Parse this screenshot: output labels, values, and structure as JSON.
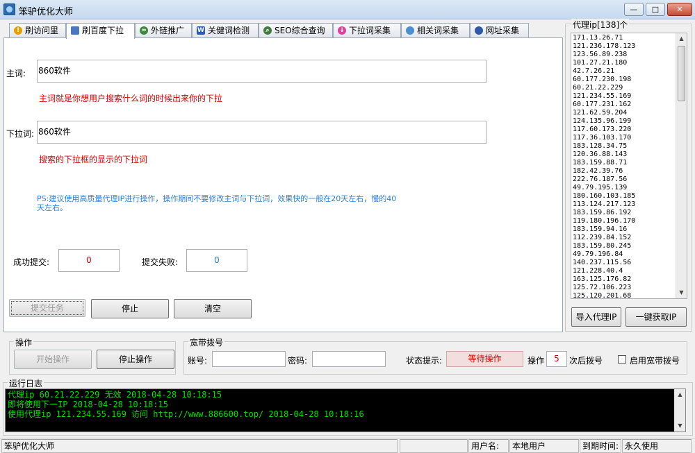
{
  "window": {
    "title": "笨驴优化大师",
    "min_label": "—",
    "max_label": "□",
    "close_label": "✕"
  },
  "tabs": [
    {
      "label": "刷访问里",
      "icon": "warning-icon",
      "color": "#e8a000"
    },
    {
      "label": "刷百度下拉",
      "icon": "page-icon",
      "color": "#4a78c0"
    },
    {
      "label": "外链推广",
      "icon": "link-icon",
      "color": "#3a8a3a"
    },
    {
      "label": "关健词检测",
      "icon": "word-icon",
      "color": "#2b5db8"
    },
    {
      "label": "SEO综合查询",
      "icon": "magnifier-icon",
      "color": "#3f7d3f"
    },
    {
      "label": "下拉词采集",
      "icon": "arrow-down-icon",
      "color": "#e0409a"
    },
    {
      "label": "相关词采集",
      "icon": "globe-icon",
      "color": "#4a90d0"
    },
    {
      "label": "网址采集",
      "icon": "globe-icon",
      "color": "#2f5aa8"
    }
  ],
  "form": {
    "main_label": "主词:",
    "main_value": "860软件",
    "main_hint": "主词就是你想用户搜索什么词的时候出来你的下拉",
    "dropdown_label": "下拉词:",
    "dropdown_value": "860软件",
    "dropdown_hint": "搜索的下拉框的显示的下拉词",
    "ps_note": "PS:建议使用高质量代理IP进行操作，操作期间不要修改主词与下拉词，效果快的一般在20天左右，慢的40天左右。",
    "success_label": "成功提交:",
    "success_value": "0",
    "fail_label": "提交失败:",
    "fail_value": "0",
    "submit_button": "提交任务",
    "stop_button": "停止",
    "clear_button": "清空"
  },
  "proxy": {
    "title": "代理ip[138]个",
    "list": [
      "171.13.26.71",
      "121.236.178.123",
      "123.56.89.238",
      "101.27.21.180",
      "42.7.26.21",
      "60.177.230.198",
      "60.21.22.229",
      "121.234.55.169",
      "60.177.231.162",
      "121.62.59.204",
      "124.135.96.199",
      "117.60.173.220",
      "117.36.103.170",
      "183.128.34.75",
      "120.36.88.143",
      "183.159.88.71",
      "182.42.39.76",
      "222.76.187.56",
      "49.79.195.139",
      "180.160.103.185",
      "113.124.217.123",
      "183.159.86.192",
      "119.180.196.170",
      "183.159.94.16",
      "112.239.84.152",
      "183.159.80.245",
      "49.79.196.84",
      "140.237.115.56",
      "121.228.40.4",
      "163.125.176.82",
      "125.72.106.223",
      "125.120.201.68"
    ],
    "import_button": "导入代理IP",
    "fetch_button": "一键获取IP"
  },
  "operation": {
    "title": "操作",
    "start_button": "开始操作",
    "stop_button": "停止操作"
  },
  "dialup": {
    "title": "宽带拨号",
    "account_label": "账号:",
    "account_value": "",
    "password_label": "密码:",
    "password_value": "",
    "status_label": "状态提示:",
    "status_value": "等待操作",
    "op_label": "操作",
    "op_value": "5",
    "after_label": "次后拨号",
    "enable_label": "启用宽带拨号"
  },
  "log": {
    "title": "运行日志",
    "lines": [
      "代理ip 60.21.22.229 无效 2018-04-28 10:18:15",
      "即将使用下一IP 2018-04-28 10:18:15",
      "使用代理ip 121.234.55.169 访问 http://www.886600.top/ 2018-04-28 10:18:16"
    ]
  },
  "statusbar": {
    "app_name": "笨驴优化大师",
    "user_label": "用户名:",
    "user_value": "本地用户",
    "expiry_label": "到期时间:",
    "expiry_value": "永久使用"
  }
}
